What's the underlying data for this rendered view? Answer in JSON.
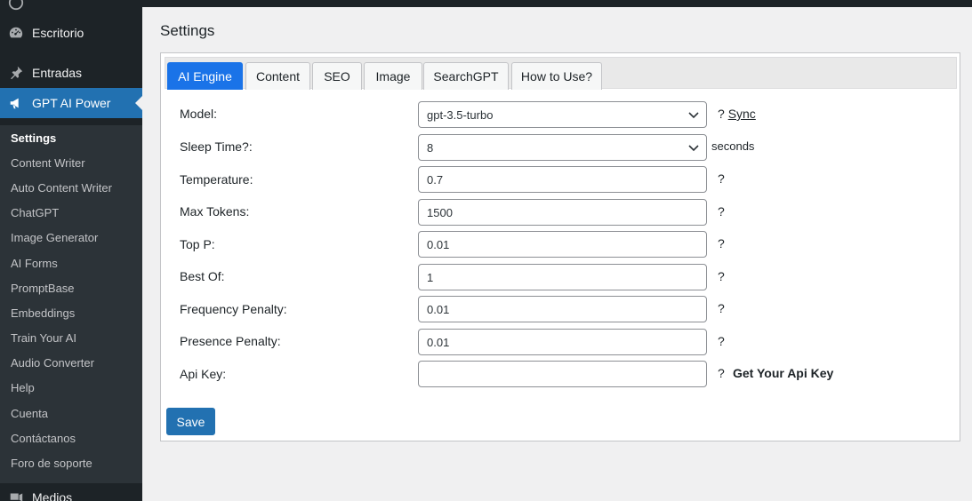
{
  "sidebar": {
    "menu": [
      {
        "label": "Escritorio",
        "icon": "dashboard-icon"
      },
      {
        "label": "Entradas",
        "icon": "pin-icon"
      },
      {
        "label": "GPT AI Power",
        "icon": "megaphone-icon"
      },
      {
        "label": "Medios",
        "icon": "media-icon"
      }
    ],
    "submenu": [
      "Settings",
      "Content Writer",
      "Auto Content Writer",
      "ChatGPT",
      "Image Generator",
      "AI Forms",
      "PromptBase",
      "Embeddings",
      "Train Your AI",
      "Audio Converter",
      "Help",
      "Cuenta",
      "Contáctanos",
      "Foro de soporte"
    ],
    "active_color": "#2271b1"
  },
  "page": {
    "title": "Settings"
  },
  "tabs": [
    "AI Engine",
    "Content",
    "SEO",
    "Image",
    "SearchGPT",
    "How to Use?"
  ],
  "form": {
    "model": {
      "label": "Model:",
      "value": "gpt-3.5-turbo",
      "help": "?",
      "link": "Sync"
    },
    "sleep_time": {
      "label": "Sleep Time?:",
      "value": "8",
      "suffix": "seconds"
    },
    "temperature": {
      "label": "Temperature:",
      "value": "0.7",
      "help": "?"
    },
    "max_tokens": {
      "label": "Max Tokens:",
      "value": "1500",
      "help": "?"
    },
    "top_p": {
      "label": "Top P:",
      "value": "0.01",
      "help": "?"
    },
    "best_of": {
      "label": "Best Of:",
      "value": "1",
      "help": "?"
    },
    "frequency_penalty": {
      "label": "Frequency Penalty:",
      "value": "0.01",
      "help": "?"
    },
    "presence_penalty": {
      "label": "Presence Penalty:",
      "value": "0.01",
      "help": "?"
    },
    "api_key": {
      "label": "Api Key:",
      "value": "",
      "help": "?",
      "link": "Get Your Api Key"
    }
  },
  "actions": {
    "save_label": "Save"
  }
}
